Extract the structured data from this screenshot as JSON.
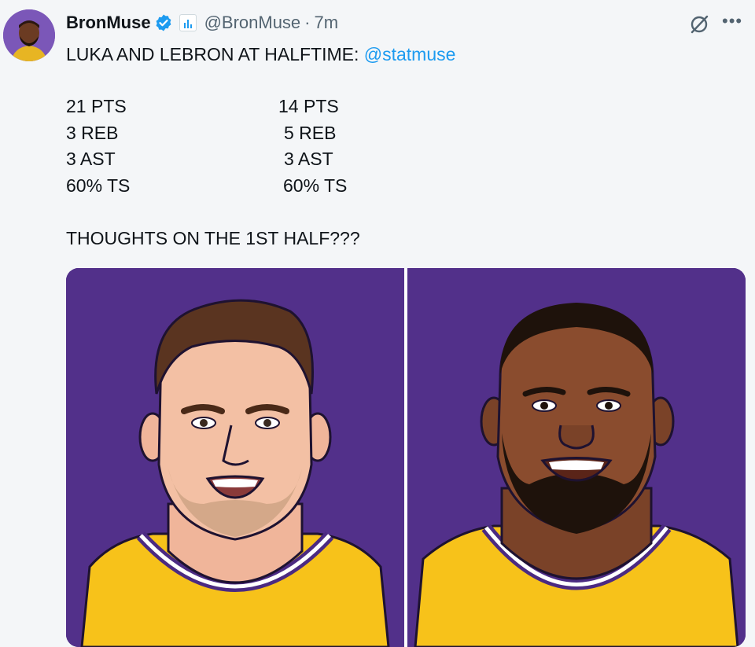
{
  "tweet": {
    "display_name": "BronMuse",
    "handle": "@BronMuse",
    "separator": "·",
    "time": "7m",
    "headline_prefix": "LUKA AND LEBRON AT HALFTIME: ",
    "mention": "@statmuse",
    "stats_left": [
      "21 PTS",
      "3 REB",
      "3 AST",
      "60% TS"
    ],
    "stats_right": [
      "14 PTS",
      "5 REB",
      "3 AST",
      "60% TS"
    ],
    "question": "THOUGHTS ON THE 1ST HALF???"
  },
  "icons": {
    "verified": "verified-badge-icon",
    "affiliate": "affiliate-badge-icon",
    "grok": "grok-icon",
    "more": "more-options-icon"
  },
  "colors": {
    "accent": "#1d9bf0",
    "muted": "#536471",
    "media_background": "#52308a",
    "jersey": "#f7c21a"
  }
}
